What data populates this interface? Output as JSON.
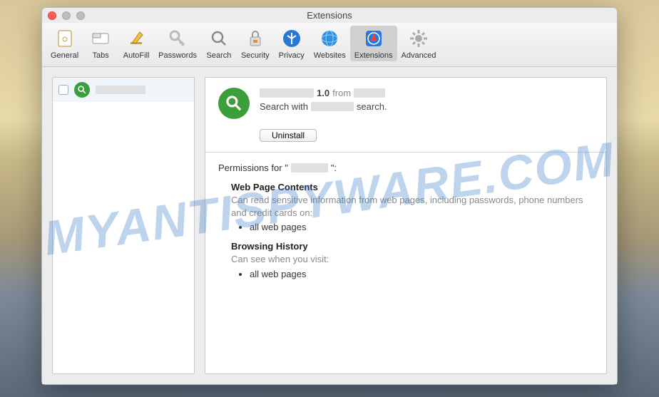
{
  "window": {
    "title": "Extensions"
  },
  "toolbar": [
    {
      "id": "general",
      "label": "General"
    },
    {
      "id": "tabs",
      "label": "Tabs"
    },
    {
      "id": "autofill",
      "label": "AutoFill"
    },
    {
      "id": "passwords",
      "label": "Passwords"
    },
    {
      "id": "search",
      "label": "Search"
    },
    {
      "id": "security",
      "label": "Security"
    },
    {
      "id": "privacy",
      "label": "Privacy"
    },
    {
      "id": "websites",
      "label": "Websites"
    },
    {
      "id": "extensions",
      "label": "Extensions",
      "selected": true
    },
    {
      "id": "advanced",
      "label": "Advanced"
    }
  ],
  "sidebar": {
    "items": [
      {
        "enabled": false,
        "name_redacted": true
      }
    ]
  },
  "detail": {
    "version": "1.0",
    "from_label": "from",
    "desc_prefix": "Search with",
    "desc_suffix": "search.",
    "uninstall_label": "Uninstall"
  },
  "permissions": {
    "header_prefix": "Permissions for \"",
    "header_suffix": "\":",
    "sections": [
      {
        "title": "Web Page Contents",
        "body": "Can read sensitive information from web pages, including passwords, phone numbers and credit cards on:",
        "items": [
          "all web pages"
        ]
      },
      {
        "title": "Browsing History",
        "body": "Can see when you visit:",
        "items": [
          "all web pages"
        ]
      }
    ]
  },
  "watermark": "MYANTISPYWARE.COM"
}
